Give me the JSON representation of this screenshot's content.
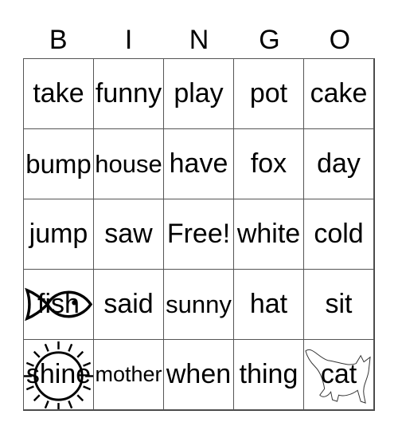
{
  "header": [
    "B",
    "I",
    "N",
    "G",
    "O"
  ],
  "cells": [
    [
      "take",
      "funny",
      "play",
      "pot",
      "cake"
    ],
    [
      "bump",
      "house",
      "have",
      "fox",
      "day"
    ],
    [
      "jump",
      "saw",
      "Free!",
      "white",
      "cold"
    ],
    [
      "fish",
      "said",
      "sunny",
      "hat",
      "sit"
    ],
    [
      "shine",
      "mother",
      "when",
      "thing",
      "cat"
    ]
  ],
  "cell_icons": {
    "3-0": "fish-icon",
    "4-0": "sun-icon",
    "4-4": "cat-icon"
  }
}
